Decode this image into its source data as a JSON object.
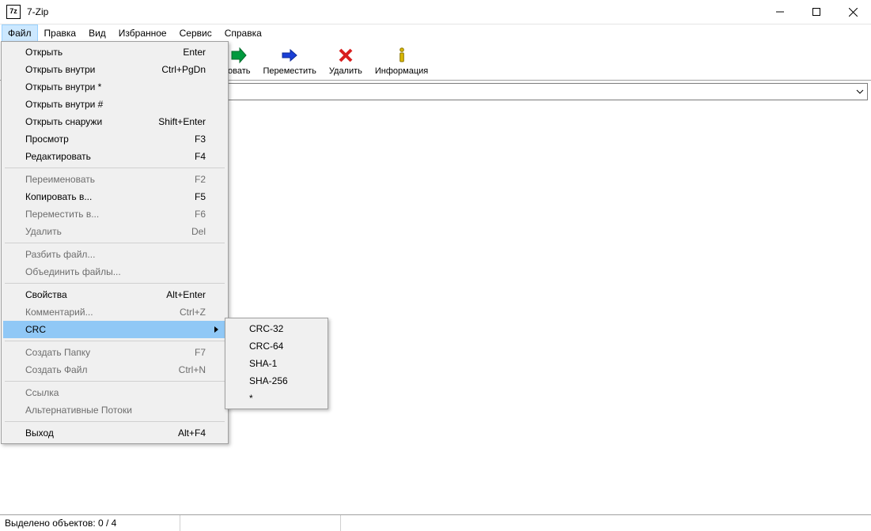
{
  "window": {
    "icon_text": "7z",
    "title": "7-Zip"
  },
  "menubar": {
    "items": [
      {
        "label": "Файл",
        "active": true
      },
      {
        "label": "Правка"
      },
      {
        "label": "Вид"
      },
      {
        "label": "Избранное"
      },
      {
        "label": "Сервис"
      },
      {
        "label": "Справка"
      }
    ]
  },
  "toolbar": {
    "buttons": [
      {
        "label": "овать",
        "icon": "arrow-green-right"
      },
      {
        "label": "Переместить",
        "icon": "arrow-blue-right"
      },
      {
        "label": "Удалить",
        "icon": "red-x"
      },
      {
        "label": "Информация",
        "icon": "info-i"
      }
    ]
  },
  "file_menu": {
    "items": [
      {
        "label": "Открыть",
        "accel": "Enter"
      },
      {
        "label": "Открыть внутри",
        "accel": "Ctrl+PgDn"
      },
      {
        "label": "Открыть внутри *",
        "accel": ""
      },
      {
        "label": "Открыть внутри #",
        "accel": ""
      },
      {
        "label": "Открыть снаружи",
        "accel": "Shift+Enter"
      },
      {
        "label": "Просмотр",
        "accel": "F3"
      },
      {
        "label": "Редактировать",
        "accel": "F4"
      },
      {
        "sep": true
      },
      {
        "label": "Переименовать",
        "accel": "F2",
        "disabled": true
      },
      {
        "label": "Копировать в...",
        "accel": "F5"
      },
      {
        "label": "Переместить в...",
        "accel": "F6",
        "disabled": true
      },
      {
        "label": "Удалить",
        "accel": "Del",
        "disabled": true
      },
      {
        "sep": true
      },
      {
        "label": "Разбить файл...",
        "disabled": true
      },
      {
        "label": "Объединить файлы...",
        "disabled": true
      },
      {
        "sep": true
      },
      {
        "label": "Свойства",
        "accel": "Alt+Enter"
      },
      {
        "label": "Комментарий...",
        "accel": "Ctrl+Z",
        "disabled": true
      },
      {
        "label": "CRC",
        "has_sub": true,
        "highlight": true
      },
      {
        "sep": true
      },
      {
        "label": "Создать Папку",
        "accel": "F7",
        "disabled": true
      },
      {
        "label": "Создать Файл",
        "accel": "Ctrl+N",
        "disabled": true
      },
      {
        "sep": true
      },
      {
        "label": "Ссылка",
        "disabled": true
      },
      {
        "label": "Альтернативные Потоки",
        "disabled": true
      },
      {
        "sep": true
      },
      {
        "label": "Выход",
        "accel": "Alt+F4"
      }
    ]
  },
  "crc_submenu": {
    "items": [
      {
        "label": "CRC-32"
      },
      {
        "label": "CRC-64"
      },
      {
        "label": "SHA-1"
      },
      {
        "label": "SHA-256"
      },
      {
        "label": "*"
      }
    ]
  },
  "statusbar": {
    "text": "Выделено объектов: 0 / 4"
  }
}
